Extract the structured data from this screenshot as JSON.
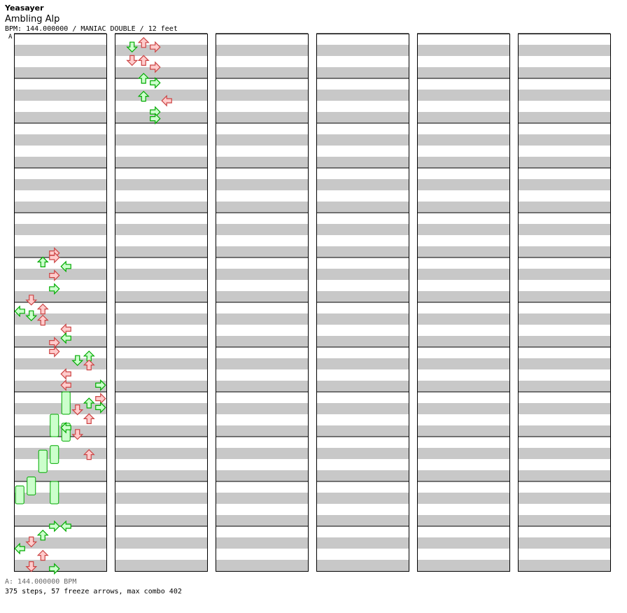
{
  "header": {
    "artist": "Yeasayer",
    "title": "Ambling Alp",
    "meta": "BPM: 144.000000 / MANIAC DOUBLE / 12 feet",
    "bpm_marker": "A"
  },
  "footer": {
    "bpm_info": "A: 144.000000 BPM",
    "stats": "375 steps, 57 freeze arrows, max combo 402"
  },
  "chart_data": {
    "type": "step-chart",
    "lanes": 8,
    "columns": 6,
    "measures_per_column": 12,
    "colors": {
      "quarter_fill": "#ccffcc",
      "quarter_stroke": "#00aa00",
      "eighth_fill": "#ffcccc",
      "eighth_stroke": "#cc4444",
      "freeze_fill": "#ccffcc",
      "freeze_stroke": "#00aa00",
      "stripe": "#c8c8c8"
    },
    "notes": [
      [
        3,
        4.9,
        "e"
      ],
      [
        3,
        5.0,
        "e"
      ],
      [
        2,
        5.1,
        "q"
      ],
      [
        4,
        5.2,
        "q"
      ],
      [
        3,
        5.4,
        "e"
      ],
      [
        3,
        5.7,
        "q"
      ],
      [
        1,
        5.95,
        "e"
      ],
      [
        0,
        6.2,
        "q"
      ],
      [
        1,
        6.3,
        "q"
      ],
      [
        2,
        6.15,
        "e"
      ],
      [
        2,
        6.4,
        "e"
      ],
      [
        4,
        6.6,
        "e"
      ],
      [
        4,
        6.8,
        "q"
      ],
      [
        3,
        6.9,
        "e"
      ],
      [
        3,
        7.1,
        "e"
      ],
      [
        5,
        7.3,
        "q"
      ],
      [
        6,
        7.2,
        "q"
      ],
      [
        6,
        7.4,
        "e"
      ],
      [
        4,
        7.6,
        "e"
      ],
      [
        4,
        7.85,
        "e"
      ],
      [
        7,
        7.85,
        "q"
      ],
      [
        7,
        8.15,
        "e"
      ],
      [
        6,
        8.25,
        "q"
      ],
      [
        7,
        8.35,
        "q"
      ],
      [
        5,
        8.4,
        "e"
      ],
      [
        6,
        8.6,
        "e"
      ],
      [
        4,
        8.8,
        "q"
      ],
      [
        5,
        8.95,
        "e"
      ],
      [
        6,
        9.4,
        "e"
      ],
      [
        4,
        11.0,
        "q"
      ],
      [
        1,
        11.35,
        "e"
      ],
      [
        2,
        11.2,
        "q"
      ],
      [
        3,
        11.0,
        "q"
      ],
      [
        0,
        11.5,
        "q"
      ],
      [
        2,
        11.65,
        "e"
      ],
      [
        1,
        11.9,
        "e"
      ],
      [
        3,
        11.95,
        "q"
      ],
      [
        2,
        12.2,
        "e"
      ],
      [
        1,
        12.3,
        "q"
      ],
      [
        3,
        12.3,
        "e"
      ],
      [
        1,
        12.6,
        "e"
      ],
      [
        2,
        12.6,
        "e"
      ],
      [
        3,
        12.75,
        "e"
      ],
      [
        2,
        13.0,
        "q"
      ],
      [
        3,
        13.1,
        "q"
      ],
      [
        2,
        13.4,
        "q"
      ],
      [
        4,
        13.5,
        "e"
      ],
      [
        3,
        13.75,
        "q"
      ],
      [
        3,
        13.9,
        "q"
      ]
    ],
    "freezes": [
      [
        4,
        8.0,
        8.5
      ],
      [
        3,
        8.5,
        9.0
      ],
      [
        4,
        8.7,
        9.1
      ],
      [
        3,
        9.2,
        9.6
      ],
      [
        2,
        9.3,
        9.8
      ],
      [
        1,
        9.9,
        10.3
      ],
      [
        3,
        10.0,
        10.5
      ],
      [
        0,
        10.1,
        10.5
      ]
    ]
  }
}
